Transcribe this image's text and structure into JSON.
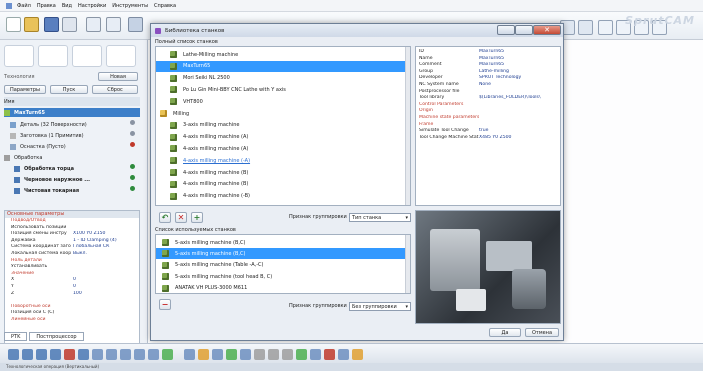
{
  "menu": [
    "Файл",
    "Правка",
    "Вид",
    "Настройки",
    "Инструменты",
    "Справка"
  ],
  "brand": "SprutCAM",
  "left_panel": {
    "technology_label": "Технология",
    "new_button": "Новая",
    "params_button": "Параметры",
    "stroke_button": "Пуск",
    "reset_button": "Сброс",
    "name_label": "Имя",
    "root_item": "MaxTurn65",
    "tree": [
      "Деталь (32 Поверхности)",
      "Заготовка (1 Примитив)",
      "Оснастка (Пусто)",
      "Обработка",
      "Обработка торца",
      "Черновое наружное ...",
      "Чистовая токарная"
    ],
    "params_header": "Основные параметры",
    "params": [
      {
        "k": "Подвод/Отвод",
        "v": "",
        "red": true
      },
      {
        "k": "Использовать позиции",
        "v": "",
        "red": false
      },
      {
        "k": "Позиция смены инстру",
        "v": "X100 Y0 Z150",
        "red": false
      },
      {
        "k": "Державка",
        "v": "1 - ID Clamping (4)",
        "red": false
      },
      {
        "k": "Система координат заго",
        "v": "Глобальная СК",
        "red": false
      },
      {
        "k": "Локальная система коор",
        "v": "Выкл.",
        "red": false
      },
      {
        "k": "Ноль детали",
        "v": "",
        "red": true
      },
      {
        "k": "Устанавливать",
        "v": "",
        "red": false
      },
      {
        "k": "Значение",
        "v": "",
        "red": true
      },
      {
        "k": "X",
        "v": "0",
        "red": false
      },
      {
        "k": "Y",
        "v": "0",
        "red": false
      },
      {
        "k": "Z",
        "v": "100",
        "red": false
      },
      {
        "k": "",
        "v": "",
        "red": false
      },
      {
        "k": "Поворотные оси",
        "v": "",
        "red": true
      },
      {
        "k": "Позиция оси C (C)",
        "v": "",
        "red": false
      },
      {
        "k": "Линейные оси",
        "v": "",
        "red": true
      }
    ],
    "tabs": [
      "PTK",
      "Постпроцессор"
    ]
  },
  "dialog": {
    "title": "Библиотека станков",
    "full_list_label": "Полный список станков",
    "full_list": [
      {
        "label": "Lathe-Milling machine",
        "type": "item",
        "sel": false
      },
      {
        "label": "MaxTurn65",
        "type": "item",
        "sel": true
      },
      {
        "label": "Mori Seiki NL 2500",
        "type": "item",
        "sel": false
      },
      {
        "label": "Po Lu Gin Mini-BBY CNC Lathe with Y axis",
        "type": "item",
        "sel": false
      },
      {
        "label": "VHT800",
        "type": "item",
        "sel": false
      },
      {
        "label": "Milling",
        "type": "folder",
        "sel": false
      },
      {
        "label": "3-axis milling machine",
        "type": "item",
        "sel": false
      },
      {
        "label": "4-axis milling machine (A)",
        "type": "item",
        "sel": false
      },
      {
        "label": "4-axis milling machine (A)",
        "type": "item",
        "sel": false
      },
      {
        "label": "4-axis milling machine (-A)",
        "type": "link",
        "sel": false
      },
      {
        "label": "4-axis milling machine (B)",
        "type": "item",
        "sel": false
      },
      {
        "label": "4-axis milling machine (B)",
        "type": "item",
        "sel": false
      },
      {
        "label": "4-axis milling machine (-B)",
        "type": "item",
        "sel": false
      }
    ],
    "props": [
      {
        "k": "ID",
        "v": "MaxTurn65",
        "red": false
      },
      {
        "k": "Name",
        "v": "MaxTurn65",
        "red": false
      },
      {
        "k": "Comment",
        "v": "MaxTurn65",
        "red": false
      },
      {
        "k": "Group",
        "v": "Lathe-milling",
        "red": false
      },
      {
        "k": "Developer",
        "v": "SPRUT Technology",
        "red": false
      },
      {
        "k": "NC System name",
        "v": "None",
        "red": false
      },
      {
        "k": "Postprocessor file",
        "v": "",
        "red": false
      },
      {
        "k": "Tool library",
        "v": "$(Libraries_FOLDER)\\Tools\\",
        "red": false
      },
      {
        "k": "Control Parameters",
        "v": "",
        "red": true
      },
      {
        "k": "Origin",
        "v": "",
        "red": true
      },
      {
        "k": "Machine state parameters",
        "v": "",
        "red": true
      },
      {
        "k": "Frame",
        "v": "",
        "red": true
      },
      {
        "k": "Simulate Tool Change",
        "v": "true",
        "red": false
      },
      {
        "k": "Tool Change Machine Stat",
        "v": "X485 Y0 Z500",
        "red": false
      }
    ],
    "group_label": "Признак группировки",
    "group_value_top": "Тип станка",
    "used_list_label": "Список используемых станков",
    "used_list": [
      {
        "label": "5-axis milling machine (B,C)",
        "sel": false
      },
      {
        "label": "5-axis milling machine (B,C)",
        "sel": true
      },
      {
        "label": "5-axis milling machine (Table -A,-C)",
        "sel": false
      },
      {
        "label": "5-axis milling machine (tool head B, C)",
        "sel": false
      },
      {
        "label": "ANATAK VH PLUS-3000 M611",
        "sel": false
      }
    ],
    "group_value_bottom": "Без группировки",
    "ok_button": "Да",
    "cancel_button": "Отмена"
  },
  "status": "Технологическая операция (Вертикальный)"
}
